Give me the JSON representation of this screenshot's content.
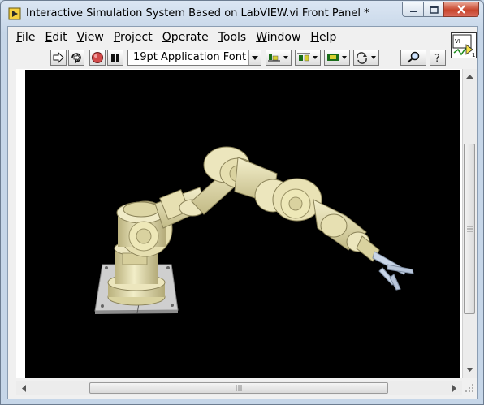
{
  "window": {
    "title": "Interactive Simulation System Based on LabVIEW.vi Front Panel *",
    "icon": "labview-app-icon"
  },
  "menubar": {
    "items": [
      {
        "label": "File",
        "mnemonic": "F",
        "rest": "ile"
      },
      {
        "label": "Edit",
        "mnemonic": "E",
        "rest": "dit"
      },
      {
        "label": "View",
        "mnemonic": "V",
        "rest": "iew"
      },
      {
        "label": "Project",
        "mnemonic": "P",
        "rest": "roject"
      },
      {
        "label": "Operate",
        "mnemonic": "O",
        "rest": "perate"
      },
      {
        "label": "Tools",
        "mnemonic": "T",
        "rest": "ools"
      },
      {
        "label": "Window",
        "mnemonic": "W",
        "rest": "indow"
      },
      {
        "label": "Help",
        "mnemonic": "H",
        "rest": "elp"
      }
    ]
  },
  "toolbar": {
    "font_select": "19pt Application Font",
    "buttons": [
      "run-arrow-icon",
      "run-continuously-icon",
      "abort-icon",
      "pause-icon",
      "align-objects-icon",
      "distribute-objects-icon",
      "resize-objects-icon",
      "reorder-icon",
      "search-icon",
      "help-icon"
    ]
  },
  "colors": {
    "scene_background": "#000000",
    "robot_body": "#eee8b8",
    "robot_shadow": "#b5ad7a",
    "base_plate": "#cfcfcf",
    "gripper": "#c9d6e8"
  },
  "scene": {
    "content": "3d-robot-arm"
  }
}
